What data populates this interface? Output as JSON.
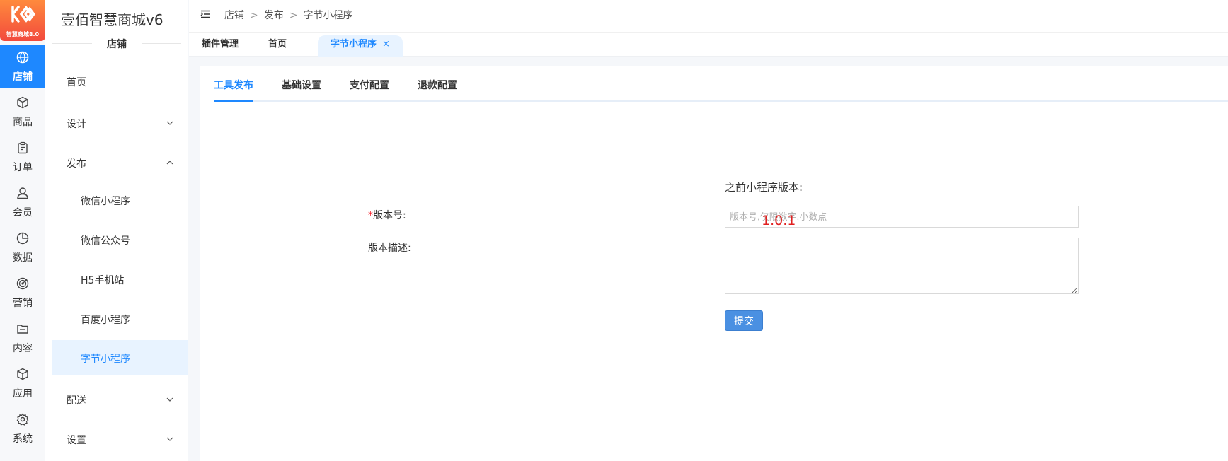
{
  "colors": {
    "primary": "#1e88ff",
    "logo_gradient_start": "#ff8a3d",
    "logo_gradient_end": "#f24a3d",
    "highlight": "#e02020"
  },
  "logo": {
    "badge_text": "智慧商城8.0",
    "icon": "logo-mark-icon"
  },
  "rail": {
    "items": [
      {
        "label": "店铺",
        "icon": "globe-icon",
        "active": true
      },
      {
        "label": "商品",
        "icon": "cube-icon"
      },
      {
        "label": "订单",
        "icon": "clipboard-icon"
      },
      {
        "label": "会员",
        "icon": "user-icon"
      },
      {
        "label": "数据",
        "icon": "pie-chart-icon"
      },
      {
        "label": "营销",
        "icon": "target-icon"
      },
      {
        "label": "内容",
        "icon": "folder-icon"
      },
      {
        "label": "应用",
        "icon": "box-icon"
      },
      {
        "label": "系统",
        "icon": "gear-icon"
      }
    ]
  },
  "menu": {
    "title": "壹佰智慧商城v6",
    "section": "店铺",
    "items": {
      "home": "首页",
      "design": "设计",
      "publish": "发布",
      "wechat_mini": "微信小程序",
      "wechat_official": "微信公众号",
      "h5": "H5手机站",
      "baidu_mini": "百度小程序",
      "bytedance_mini": "字节小程序",
      "delivery": "配送",
      "settings": "设置"
    }
  },
  "header": {
    "breadcrumbs": [
      "店铺",
      "发布",
      "字节小程序"
    ],
    "separator": ">"
  },
  "tabs": {
    "items": [
      "插件管理",
      "首页",
      "字节小程序"
    ],
    "close": "×"
  },
  "content": {
    "sub_tabs": [
      "工具发布",
      "基础设置",
      "支付配置",
      "退款配置"
    ],
    "form": {
      "prev_version_label": "之前小程序版本:",
      "required_mark": "*",
      "version_label": "版本号:",
      "version_placeholder": "版本号,仅限数字,小数点",
      "version_overlay_value": "1.0.1",
      "description_label": "版本描述:",
      "submit_label": "提交"
    }
  }
}
